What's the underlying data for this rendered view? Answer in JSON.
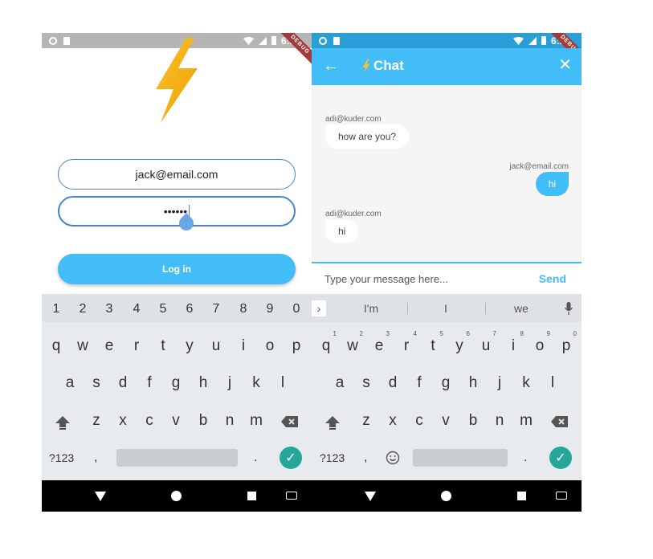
{
  "status_bar": {
    "time": "6:20",
    "debug_label": "DEBUG"
  },
  "login": {
    "email_value": "jack@email.com",
    "password_value": "••••••",
    "login_label": "Log in"
  },
  "chat": {
    "title": "Chat",
    "messages": [
      {
        "sender": "adi@kuder.com",
        "text": "how are you?"
      },
      {
        "sender": "jack@email.com",
        "text": "hi"
      },
      {
        "sender": "adi@kuder.com",
        "text": "hi"
      }
    ],
    "input_placeholder": "Type your message here...",
    "send_label": "Send"
  },
  "keyboard": {
    "number_row": [
      "1",
      "2",
      "3",
      "4",
      "5",
      "6",
      "7",
      "8",
      "9",
      "0"
    ],
    "row1": [
      "q",
      "w",
      "e",
      "r",
      "t",
      "y",
      "u",
      "i",
      "o",
      "p"
    ],
    "row2": [
      "a",
      "s",
      "d",
      "f",
      "g",
      "h",
      "j",
      "k",
      "l"
    ],
    "row3": [
      "z",
      "x",
      "c",
      "v",
      "b",
      "n",
      "m"
    ],
    "symbols_label": "?123",
    "comma": ",",
    "period": ".",
    "suggestions": [
      "I'm",
      "I",
      "we"
    ]
  },
  "colors": {
    "accent": "#42bdf8",
    "enter": "#26a69a",
    "debug": "#a53a3a"
  }
}
